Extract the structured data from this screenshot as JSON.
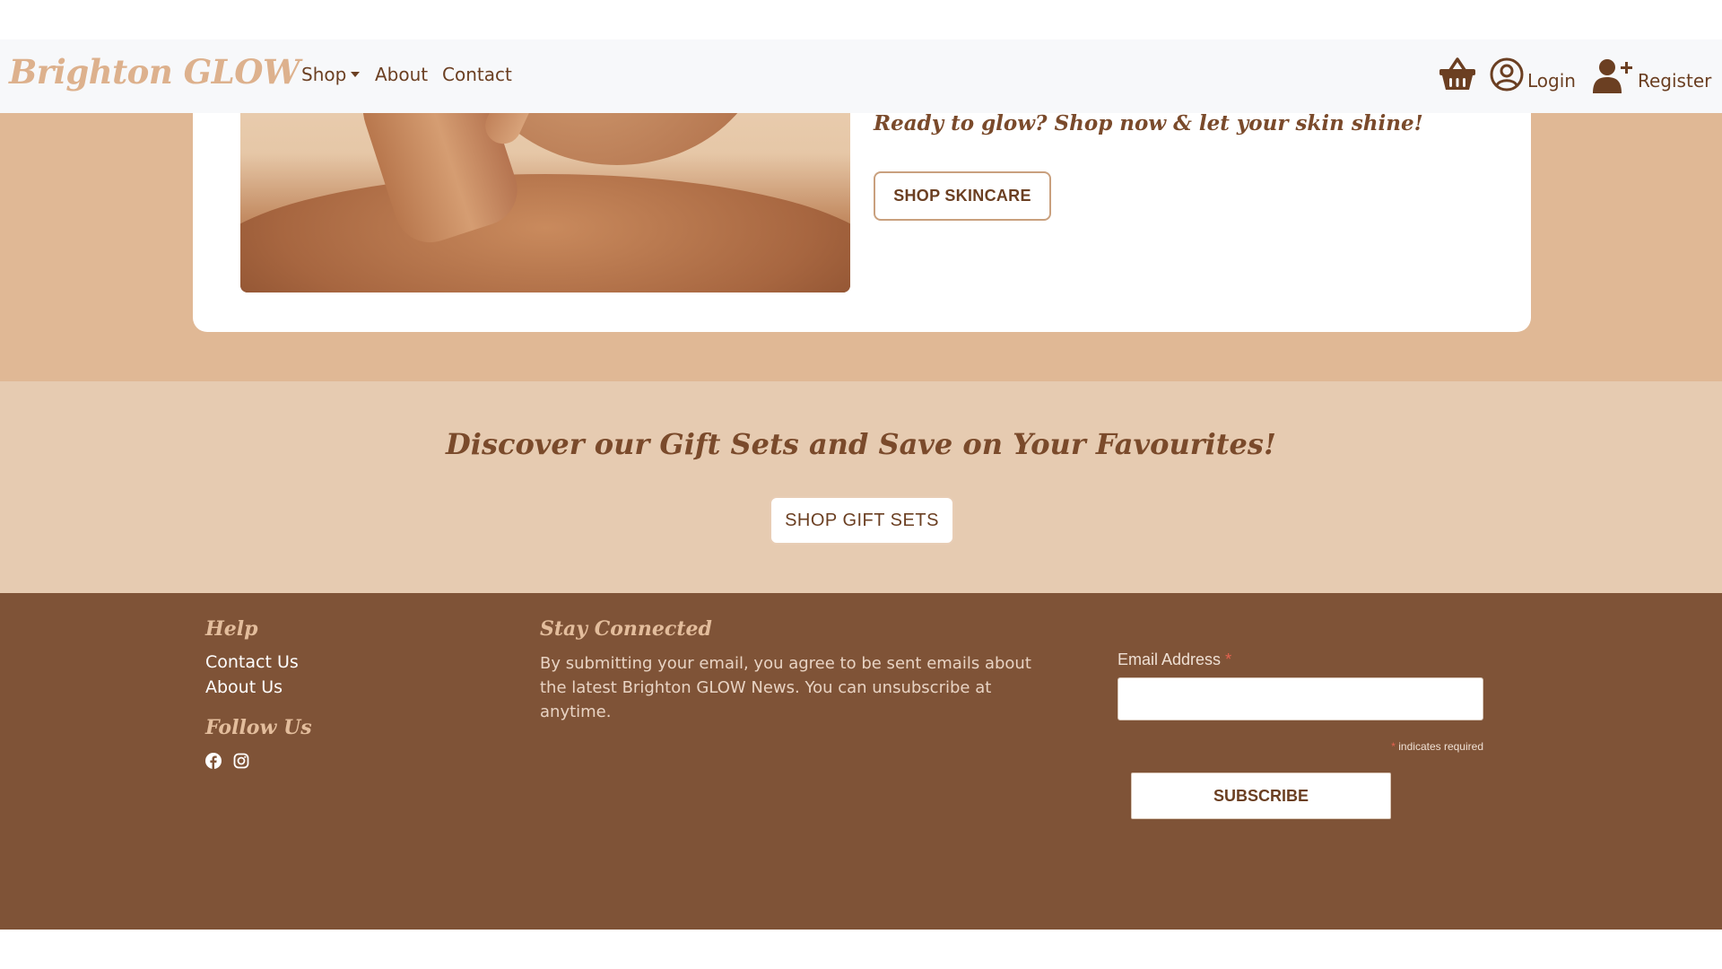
{
  "navbar": {
    "brand": "Brighton GLOW",
    "links": {
      "shop": "Shop",
      "about": "About",
      "contact": "Contact"
    },
    "login_label": "Login",
    "register_label": "Register",
    "icons": {
      "basket": "basket-icon",
      "login": "user-circle-icon",
      "register": "user-plus-icon"
    }
  },
  "hero": {
    "tagline": "Ready to glow? Shop now & let your skin shine!",
    "button_label": "SHOP SKINCARE"
  },
  "gift": {
    "heading": "Discover our Gift Sets and Save on Your Favourites!",
    "button_label": "SHOP GIFT SETS"
  },
  "footer": {
    "help": {
      "heading": "Help",
      "links": [
        "Contact Us",
        "About Us"
      ]
    },
    "follow": {
      "heading": "Follow Us",
      "icons": [
        "facebook-icon",
        "instagram-icon"
      ]
    },
    "stay": {
      "heading": "Stay Connected",
      "text": "By submitting your email, you agree to be sent emails about the latest Brighton GLOW News. You can unsubscribe at anytime."
    },
    "form": {
      "email_label": "Email Address",
      "required_star": "*",
      "required_note": "indicates required",
      "email_value": "",
      "subscribe_label": "SUBSCRIBE"
    }
  },
  "colors": {
    "brown": "#7f5337",
    "tan_band": "#e0b895",
    "light_tan_band": "#e6cbb1",
    "brand_gold": "#ddb18d",
    "text_brown": "#6b3f22"
  }
}
